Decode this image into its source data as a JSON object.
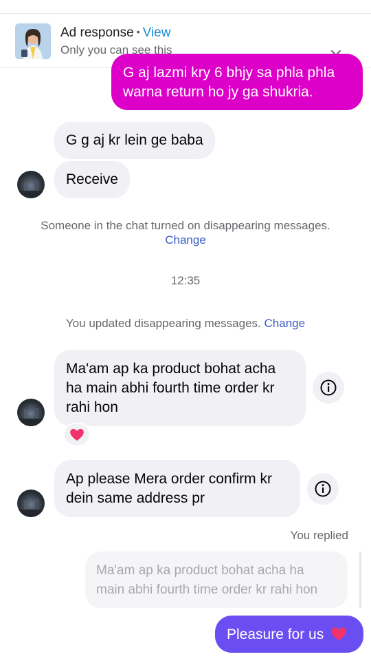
{
  "ad_banner": {
    "title": "Ad response",
    "separator": "•",
    "view_link": "View",
    "subtitle": "Only you can see this",
    "close_icon": "close-icon"
  },
  "messages": {
    "outgoing_1": {
      "line1": "G aj lazmi kry 6 bhjy sa phla phla",
      "line2": "warna return ho jy ga shukria."
    },
    "incoming_1": "G g aj kr lein ge baba",
    "incoming_2": "Receive",
    "system_1": {
      "text": "Someone in the chat turned on disappearing messages.",
      "link": "Change"
    },
    "timestamp": "12:35",
    "system_2": {
      "text": "You updated disappearing messages.",
      "link": "Change"
    },
    "incoming_3": {
      "line1": "Ma'am ap ka product bohat acha",
      "line2": "ha main abhi fourth time order kr",
      "line3": "rahi hon"
    },
    "incoming_3_reaction": "heart",
    "incoming_4": {
      "line1": "Ap please Mera order confirm kr",
      "line2": "dein same address pr"
    },
    "replied_label": "You replied",
    "reply_preview": {
      "line1": "Ma'am ap ka product bohat acha ha",
      "line2": "main abhi fourth time order kr rahi hon"
    },
    "outgoing_2": {
      "text": "Pleasure for us",
      "emoji": "heart"
    }
  },
  "colors": {
    "pink_bubble": "#dc00c8",
    "purple_bubble": "#6b4ef2",
    "incoming_bubble": "#f0f0f5",
    "link_blue": "#3b5cc4",
    "view_blue": "#1a8fd6",
    "heart": "#f0336a"
  }
}
